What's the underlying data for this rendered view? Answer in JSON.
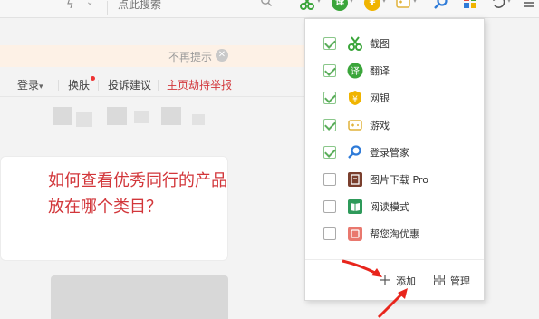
{
  "toolbar": {
    "search_placeholder": "点此搜索",
    "ext_cut_icon": "scissors-icon",
    "ext_translate_char": "译",
    "ext_bank_char": "¥",
    "more_icon": "more-menu-icon"
  },
  "notice": {
    "text": "不再提示"
  },
  "page_nav": {
    "login": "登录",
    "skin": "换肤",
    "feedback": "投诉建议",
    "report": "主页劫持举报"
  },
  "question": {
    "line1": "如何查看优秀同行的产品",
    "line2": "放在哪个类目？"
  },
  "menu": {
    "items": [
      {
        "label": "截图",
        "checked": true,
        "icon": "scissors-icon"
      },
      {
        "label": "翻译",
        "checked": true,
        "icon": "translate-icon"
      },
      {
        "label": "网银",
        "checked": true,
        "icon": "shield-yuan-icon"
      },
      {
        "label": "游戏",
        "checked": true,
        "icon": "gamepad-icon"
      },
      {
        "label": "登录管家",
        "checked": true,
        "icon": "key-icon"
      },
      {
        "label": "图片下载 Pro",
        "checked": false,
        "icon": "image-download-icon"
      },
      {
        "label": "阅读模式",
        "checked": false,
        "icon": "book-icon"
      },
      {
        "label": "帮您淘优惠",
        "checked": false,
        "icon": "coupon-icon"
      }
    ],
    "add_label": "添加",
    "manage_label": "管理"
  },
  "colors": {
    "accent_green": "#5aad5a",
    "question_red": "#d2363a",
    "annotation_red": "#e8251c"
  }
}
